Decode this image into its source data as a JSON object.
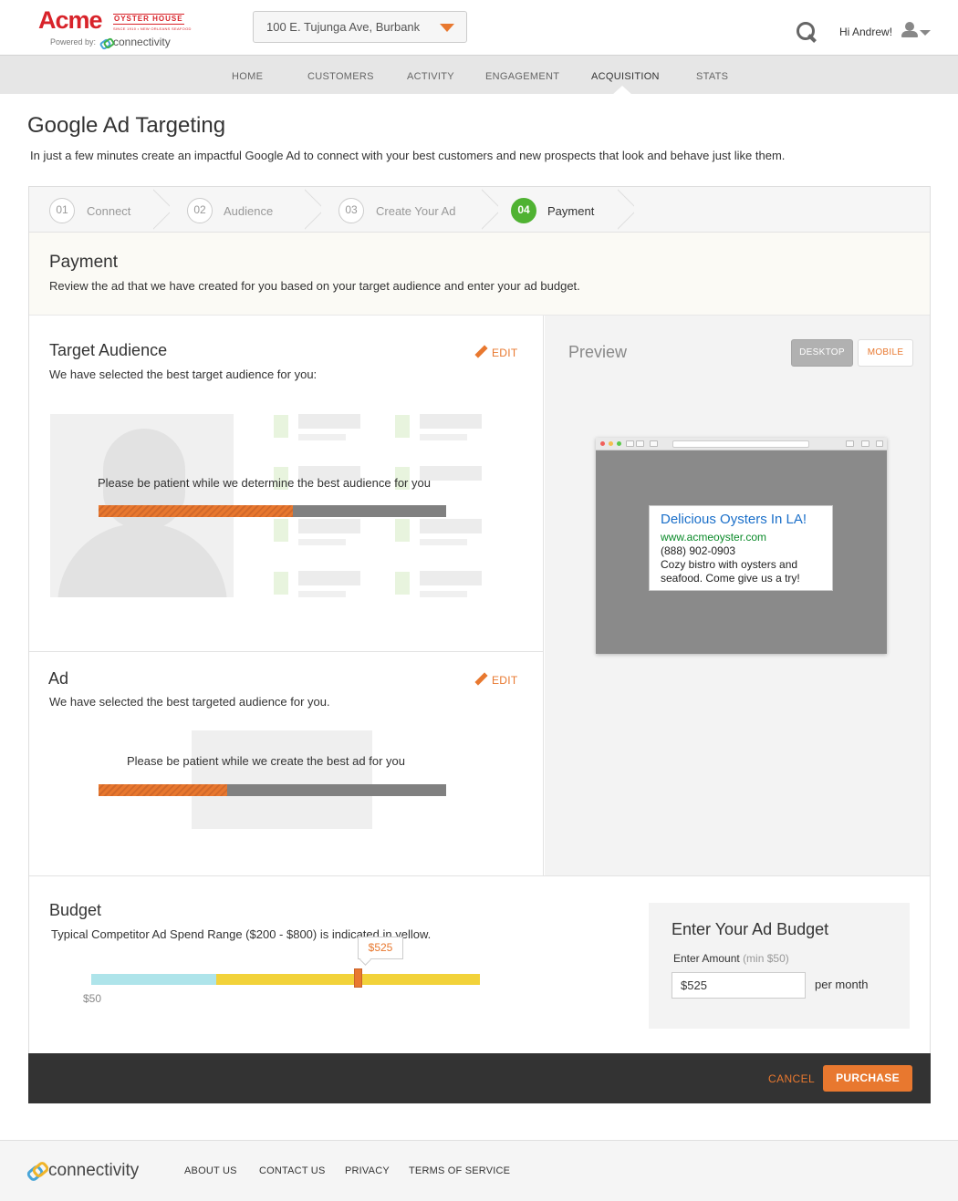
{
  "brand": {
    "name": "Acme",
    "tagline": "OYSTER HOUSE",
    "subtag": "SINCE 1910 • NEW ORLEANS SEAFOOD",
    "powered_by": "Powered by:",
    "partner": "connectivity"
  },
  "location": {
    "value": "100 E. Tujunga Ave, Burbank"
  },
  "user": {
    "greeting": "Hi Andrew!"
  },
  "nav": {
    "items": [
      {
        "label": "HOME"
      },
      {
        "label": "CUSTOMERS"
      },
      {
        "label": "ACTIVITY"
      },
      {
        "label": "ENGAGEMENT"
      },
      {
        "label": "ACQUISITION",
        "active": true
      },
      {
        "label": "STATS"
      }
    ]
  },
  "page": {
    "title": "Google Ad Targeting",
    "description": "In just a few minutes create an impactful Google Ad to connect with your best customers and new prospects that look and behave just like them."
  },
  "steps": [
    {
      "number": "01",
      "label": "Connect"
    },
    {
      "number": "02",
      "label": "Audience"
    },
    {
      "number": "03",
      "label": "Create Your Ad"
    },
    {
      "number": "04",
      "label": "Payment",
      "active": true
    }
  ],
  "payment": {
    "title": "Payment",
    "description": "Review the ad that we have created for you based on your target audience and enter your ad budget."
  },
  "target_audience": {
    "title": "Target Audience",
    "description": "We have selected the best target audience for you:",
    "edit_label": "EDIT",
    "loading_text": "Please be patient while we determine the best audience for you",
    "progress": 0.56
  },
  "ad": {
    "title": "Ad",
    "description": "We have selected the best targeted audience for you.",
    "edit_label": "EDIT",
    "loading_text": "Please be patient while we create the best ad for you",
    "progress": 0.37
  },
  "preview": {
    "title": "Preview",
    "desktop_label": "DESKTOP",
    "mobile_label": "MOBILE",
    "selected": "desktop",
    "ad_headline": "Delicious Oysters In LA!",
    "ad_url": "www.acmeoyster.com",
    "ad_phone": "(888) 902-0903",
    "ad_text_1": "Cozy bistro with oysters and",
    "ad_text_2": "seafood. Come give us a try!"
  },
  "budget": {
    "title": "Budget",
    "description": "Typical Competitor Ad Spend Range  ($200 - $800) is indicated in yellow.",
    "current_label": "$525",
    "min_label": "$50",
    "box_title": "Enter Your Ad Budget",
    "amount_label": "Enter Amount",
    "amount_hint": "(min $50)",
    "amount_value": "$525",
    "unit": "per month"
  },
  "actions": {
    "cancel": "CANCEL",
    "purchase": "PURCHASE"
  },
  "footer": {
    "brand": "connectivity",
    "links": [
      {
        "label": "ABOUT US"
      },
      {
        "label": "CONTACT US"
      },
      {
        "label": "PRIVACY"
      },
      {
        "label": "TERMS OF SERVICE"
      }
    ]
  },
  "colors": {
    "accent": "#e8782f",
    "step_active": "#4fb232",
    "slider_range": "#f2d23a",
    "slider_low": "#aee4ea"
  }
}
